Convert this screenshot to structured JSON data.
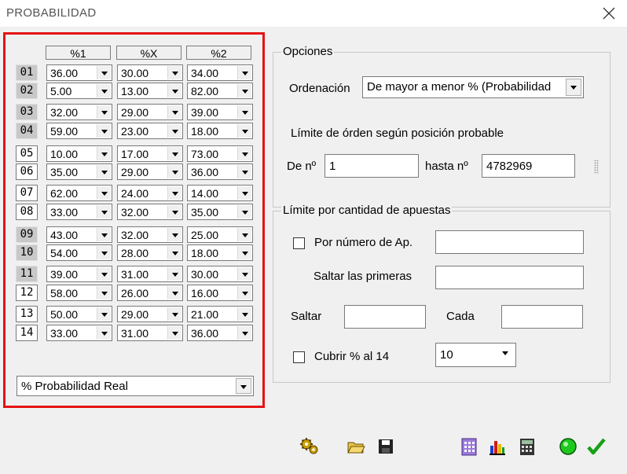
{
  "window": {
    "title": "PROBABILIDAD"
  },
  "grid": {
    "headers": [
      "%1",
      "%X",
      "%2"
    ],
    "rows": [
      {
        "n": "01",
        "shade": "dark",
        "v": [
          "36.00",
          "30.00",
          "34.00"
        ]
      },
      {
        "n": "02",
        "shade": "dark",
        "v": [
          "5.00",
          "13.00",
          "82.00"
        ]
      },
      {
        "n": "03",
        "shade": "dark",
        "v": [
          "32.00",
          "29.00",
          "39.00"
        ]
      },
      {
        "n": "04",
        "shade": "dark",
        "v": [
          "59.00",
          "23.00",
          "18.00"
        ]
      },
      {
        "n": "05",
        "shade": "light",
        "v": [
          "10.00",
          "17.00",
          "73.00"
        ]
      },
      {
        "n": "06",
        "shade": "light",
        "v": [
          "35.00",
          "29.00",
          "36.00"
        ]
      },
      {
        "n": "07",
        "shade": "light",
        "v": [
          "62.00",
          "24.00",
          "14.00"
        ]
      },
      {
        "n": "08",
        "shade": "light",
        "v": [
          "33.00",
          "32.00",
          "35.00"
        ]
      },
      {
        "n": "09",
        "shade": "dark",
        "v": [
          "43.00",
          "32.00",
          "25.00"
        ]
      },
      {
        "n": "10",
        "shade": "dark",
        "v": [
          "54.00",
          "28.00",
          "18.00"
        ]
      },
      {
        "n": "11",
        "shade": "dark",
        "v": [
          "39.00",
          "31.00",
          "30.00"
        ]
      },
      {
        "n": "12",
        "shade": "light",
        "v": [
          "58.00",
          "26.00",
          "16.00"
        ]
      },
      {
        "n": "13",
        "shade": "light",
        "v": [
          "50.00",
          "29.00",
          "21.00"
        ]
      },
      {
        "n": "14",
        "shade": "light",
        "v": [
          "33.00",
          "31.00",
          "36.00"
        ]
      }
    ],
    "mode_select": "% Probabilidad Real"
  },
  "options": {
    "legend": "Opciones",
    "ordenacion_label": "Ordenación",
    "ordenacion_value": "De mayor a menor % (Probabilidad",
    "limit_title": "Límite de órden según posición probable",
    "from_label": "De nº",
    "from_value": "1",
    "to_label": "hasta nº",
    "to_value": "4782969"
  },
  "bets": {
    "legend": "Límite por cantidad de apuestas",
    "por_numero_label": "Por número de Ap.",
    "por_numero_value": "",
    "saltar_primeras_label": "Saltar las primeras",
    "saltar_primeras_value": "",
    "saltar_label": "Saltar",
    "saltar_value": "",
    "cada_label": "Cada",
    "cada_value": "",
    "cubrir_label": "Cubrir % al 14",
    "cubrir_value": "10"
  },
  "toolbar": {
    "icons": [
      "gears-icon",
      "open-folder-icon",
      "save-disk-icon",
      "calculator-grid-icon",
      "bar-chart-icon",
      "calculator-icon",
      "green-light-icon",
      "checkmark-icon"
    ]
  }
}
